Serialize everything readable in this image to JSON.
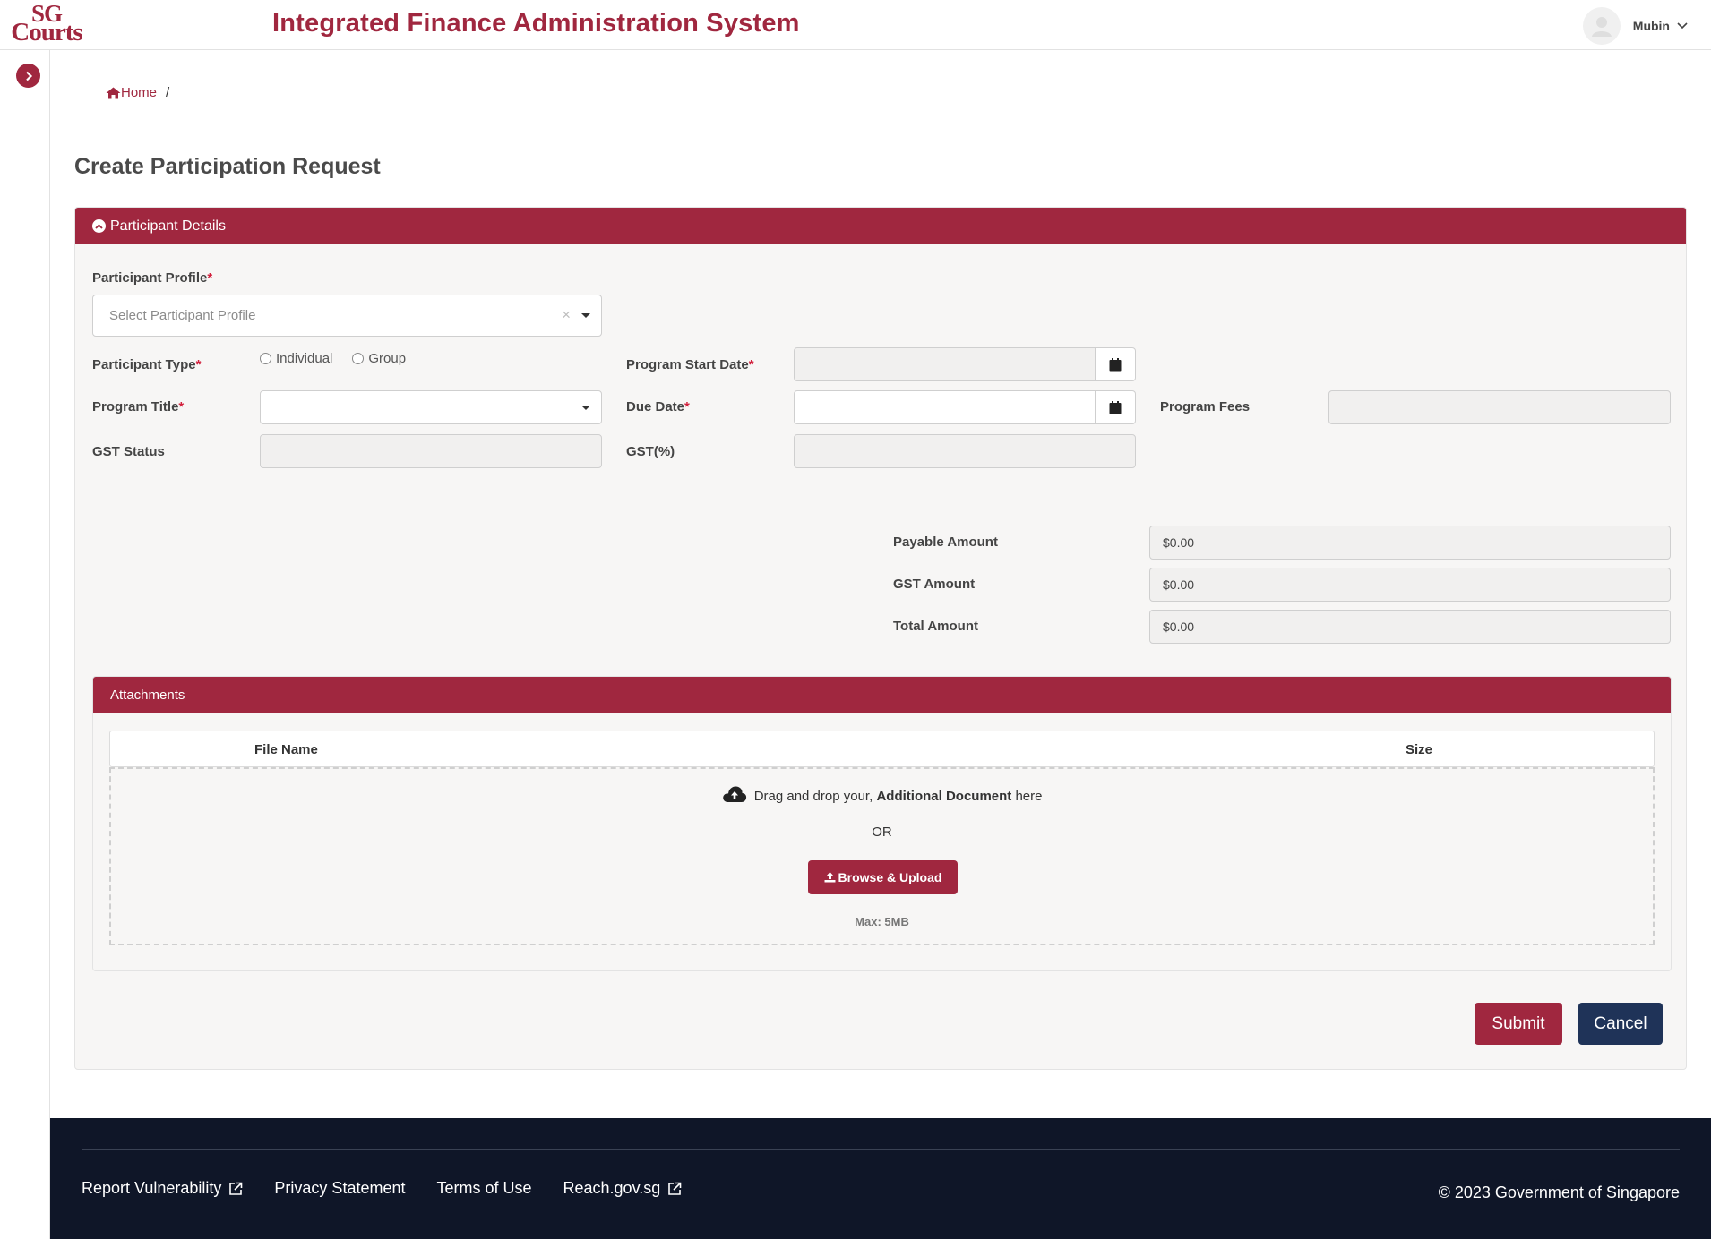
{
  "header": {
    "logo_line1": "SG",
    "logo_line2": "Courts",
    "app_title": "Integrated Finance Administration System",
    "user_name": "Mubin"
  },
  "breadcrumb": {
    "home": "Home",
    "separator": "/"
  },
  "page_title": "Create Participation Request",
  "participant_details": {
    "section_title": "Participant Details",
    "participant_profile_label": "Participant Profile",
    "participant_profile_placeholder": "Select Participant Profile",
    "participant_type_label": "Participant Type",
    "participant_type_options": [
      "Individual",
      "Group"
    ],
    "program_title_label": "Program Title",
    "program_title_value": "",
    "gst_status_label": "GST Status",
    "gst_status_value": "",
    "program_start_date_label": "Program Start Date",
    "program_start_date_value": "",
    "due_date_label": "Due Date",
    "due_date_value": "",
    "gst_percent_label": "GST(%)",
    "gst_percent_value": "",
    "program_fees_label": "Program Fees",
    "program_fees_value": "",
    "required_mark": "*"
  },
  "amounts": {
    "payable_label": "Payable Amount",
    "payable_value": "$0.00",
    "gst_label": "GST Amount",
    "gst_value": "$0.00",
    "total_label": "Total Amount",
    "total_value": "$0.00"
  },
  "attachments": {
    "section_title": "Attachments",
    "columns": [
      "File Name",
      "Size"
    ],
    "drop_text_prefix": "Drag and drop your,",
    "drop_text_bold": "Additional Document",
    "drop_text_suffix": "here",
    "or_text": "OR",
    "browse_label": "Browse & Upload",
    "max_size": "Max: 5MB"
  },
  "actions": {
    "submit_label": "Submit",
    "cancel_label": "Cancel"
  },
  "footer": {
    "links": [
      "Report Vulnerability",
      "Privacy Statement",
      "Terms of Use",
      "Reach.gov.sg"
    ],
    "copyright": "© 2023 Government of Singapore"
  },
  "colors": {
    "brand": "#a0273f",
    "cancel": "#1f3358",
    "footer_bg": "#0f1628",
    "panel_bg": "#f7f6f5"
  },
  "icons": [
    "home-icon",
    "chevron-right-icon",
    "chevron-up-icon",
    "calendar-icon",
    "cloud-upload-icon",
    "upload-icon",
    "external-link-icon",
    "user-icon",
    "chevron-down-icon"
  ]
}
